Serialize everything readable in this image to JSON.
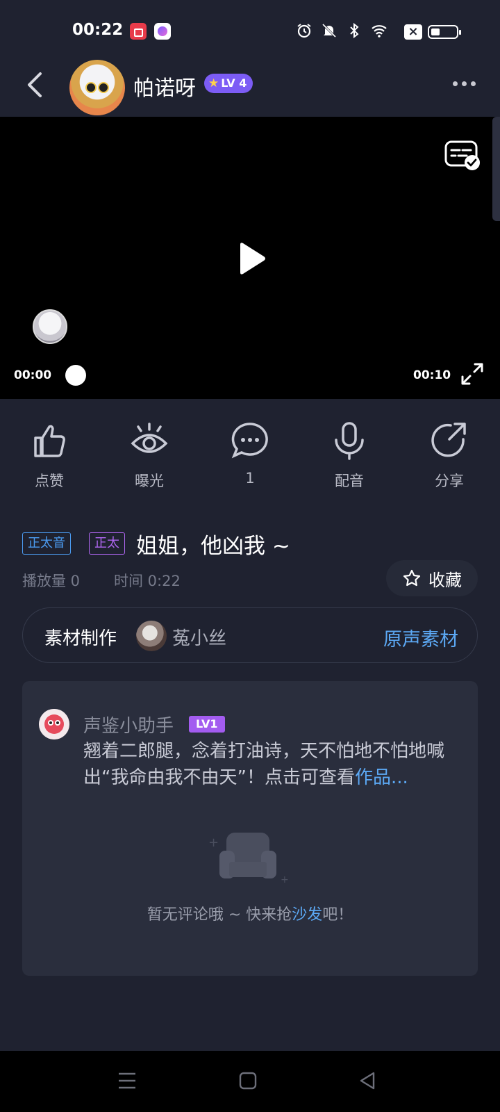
{
  "status_bar": {
    "time": "00:22",
    "icons": [
      "screen-record-icon",
      "app-icon",
      "alarm-icon",
      "mute-icon",
      "bluetooth-icon",
      "wifi-icon",
      "x-icon",
      "battery-icon"
    ]
  },
  "header": {
    "username": "帕诺呀",
    "level": "LV 4"
  },
  "video": {
    "time_current": "00:00",
    "time_total": "00:10",
    "progress": 0.0
  },
  "actions": [
    {
      "label": "点赞",
      "icon": "thumbs-up-icon"
    },
    {
      "label": "曝光",
      "icon": "eye-icon"
    },
    {
      "label": "1",
      "icon": "comment-icon"
    },
    {
      "label": "配音",
      "icon": "microphone-icon"
    },
    {
      "label": "分享",
      "icon": "share-icon"
    }
  ],
  "info": {
    "tag1": "正太音",
    "tag2": "正太",
    "title": "姐姐，他凶我 ~",
    "plays": "播放量 0",
    "time": "时间 0:22",
    "favorite": "收藏"
  },
  "material": {
    "label": "素材制作",
    "author": "菟小丝",
    "link": "原声素材"
  },
  "comment": {
    "bot_name": "声鉴小助手",
    "bot_level": "LV1",
    "text": "翘着二郎腿，念着打油诗，天不怕地不怕地喊出“我命由我不由天”！点击可查看",
    "link": "作品...",
    "empty_text": "暂无评论哦 ~ 快来抢",
    "empty_link": "沙发",
    "empty_suffix": "吧！"
  },
  "colors": {
    "background": "#1f2230",
    "accent_blue": "#5ca9f5",
    "level_purple": "#7c5cf5",
    "tag_purple": "#b067f2"
  }
}
